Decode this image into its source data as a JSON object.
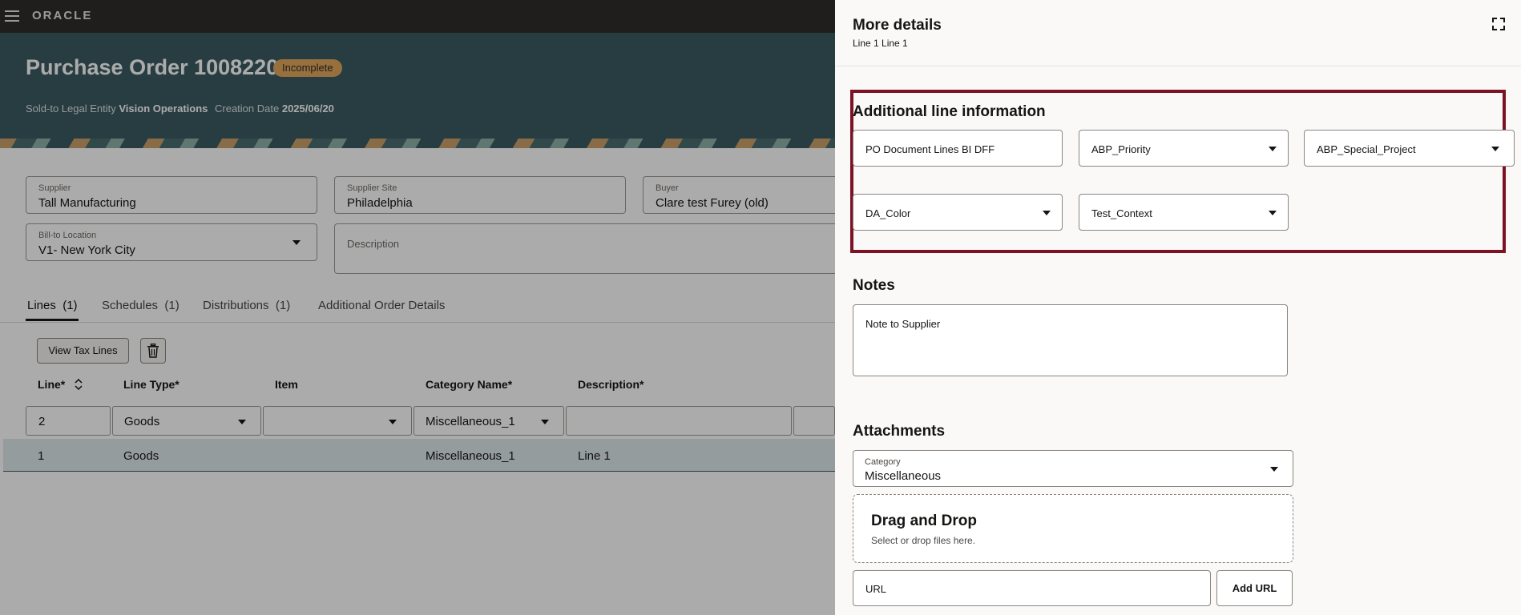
{
  "brand": {
    "logo": "ORACLE"
  },
  "header": {
    "title": "Purchase Order 1008220",
    "status": "Incomplete",
    "legal_entity_label": "Sold-to Legal Entity",
    "legal_entity_value": "Vision Operations",
    "creation_date_label": "Creation Date",
    "creation_date_value": "2025/06/20"
  },
  "form": {
    "supplier_label": "Supplier",
    "supplier_value": "Tall Manufacturing",
    "site_label": "Supplier Site",
    "site_value": "Philadelphia",
    "buyer_label": "Buyer",
    "buyer_value": "Clare test Furey (old)",
    "billto_label": "Bill-to Location",
    "billto_value": "V1- New York City",
    "description_label": "Description"
  },
  "tabs": [
    {
      "label": "Lines",
      "count": "(1)"
    },
    {
      "label": "Schedules",
      "count": "(1)"
    },
    {
      "label": "Distributions",
      "count": "(1)"
    },
    {
      "label": "Additional Order Details",
      "count": ""
    }
  ],
  "toolbar": {
    "view_tax_lines": "View Tax Lines"
  },
  "table": {
    "columns": [
      "Line*",
      "Line Type*",
      "Item",
      "Category Name*",
      "Description*"
    ],
    "edit_row": {
      "line": "2",
      "type": "Goods",
      "item": "",
      "category": "Miscellaneous_1",
      "description": ""
    },
    "rows": [
      {
        "line": "1",
        "type": "Goods",
        "item": "",
        "category": "Miscellaneous_1",
        "description": "Line 1"
      }
    ]
  },
  "drawer": {
    "title": "More details",
    "subtitle": "Line 1 Line 1",
    "additional_title": "Additional line information",
    "fields": {
      "po_lines": "PO Document Lines BI DFF",
      "priority": "ABP_Priority",
      "special_project": "ABP_Special_Project",
      "color": "DA_Color",
      "test_context": "Test_Context"
    },
    "notes_title": "Notes",
    "note_placeholder": "Note to Supplier",
    "attachments_title": "Attachments",
    "category_label": "Category",
    "category_value": "Miscellaneous",
    "dropzone_title": "Drag and Drop",
    "dropzone_sub": "Select or drop files here.",
    "url_placeholder": "URL",
    "add_url": "Add URL"
  },
  "colors": {
    "header": "#3c5c63",
    "badge": "#e2a85d",
    "highlight": "#7d1224",
    "topbar": "#312d2a"
  }
}
